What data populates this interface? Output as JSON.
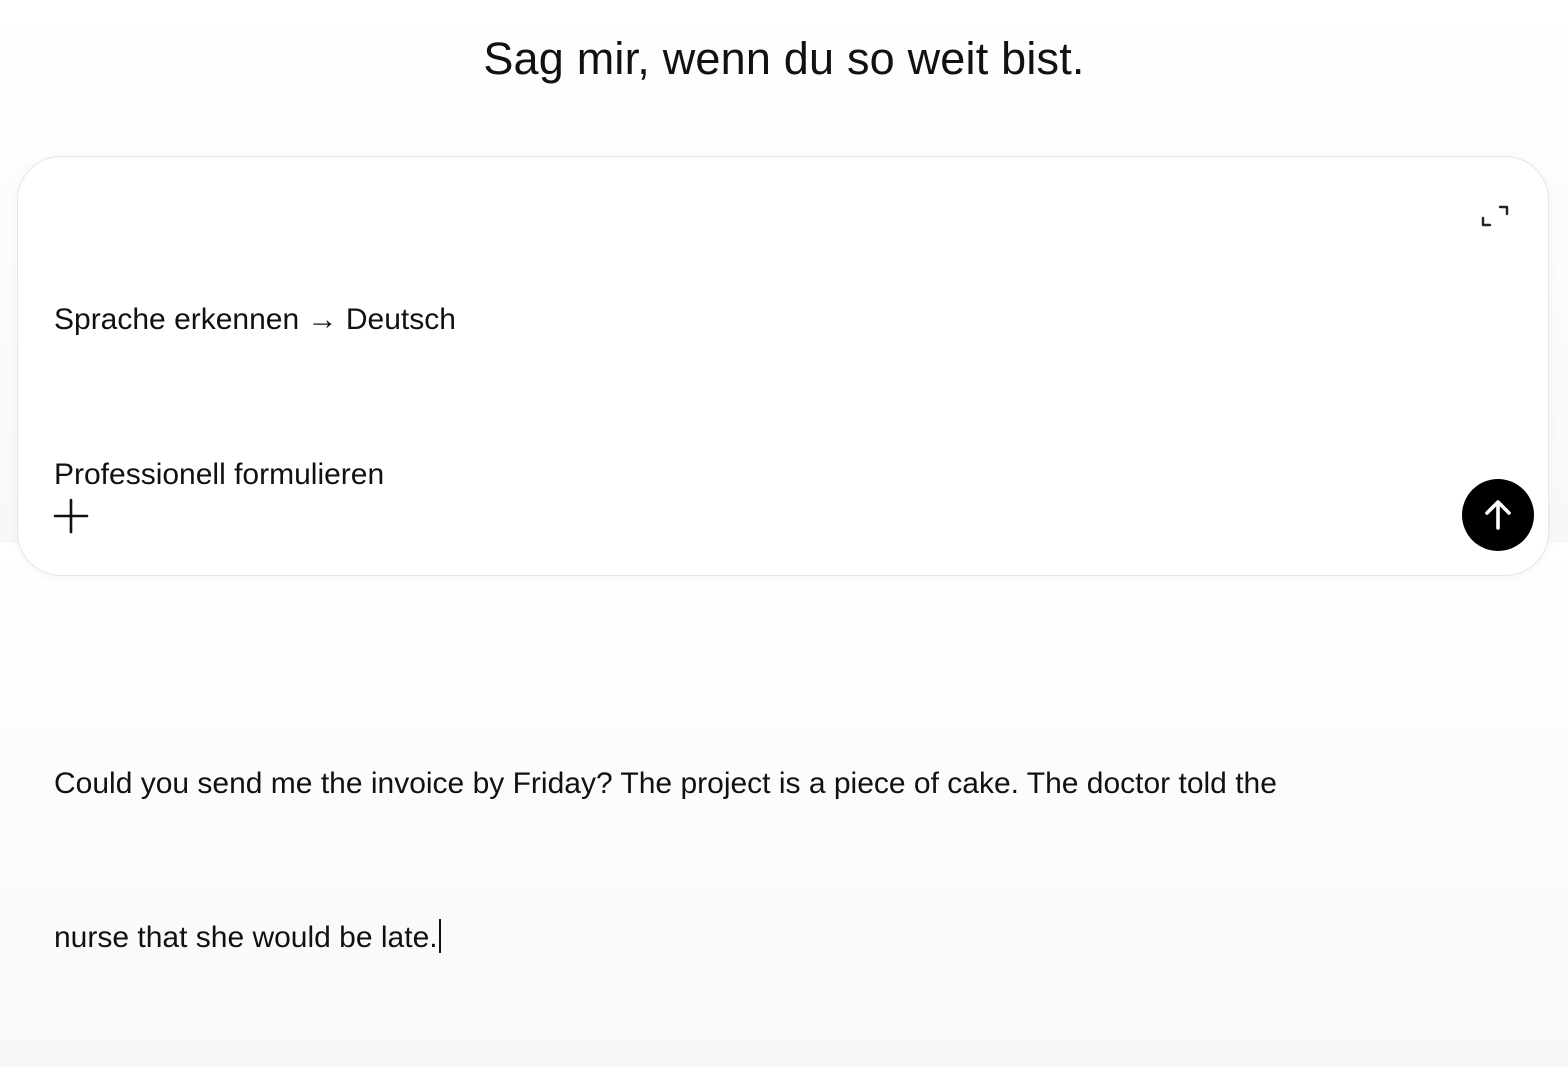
{
  "headline": "Sag mir, wenn du so weit bist.",
  "composer": {
    "lines": [
      "Sprache erkennen → Deutsch",
      "Professionell formulieren",
      "",
      "Could you send me the invoice by Friday? The project is a piece of cake. The doctor told the",
      "nurse that she would be late."
    ],
    "expand_icon": "expand-icon",
    "add_icon": "plus-icon",
    "send_icon": "arrow-up-icon"
  },
  "colors": {
    "send_button": "#000000",
    "text": "#111111",
    "background": "#f8f8f8"
  }
}
